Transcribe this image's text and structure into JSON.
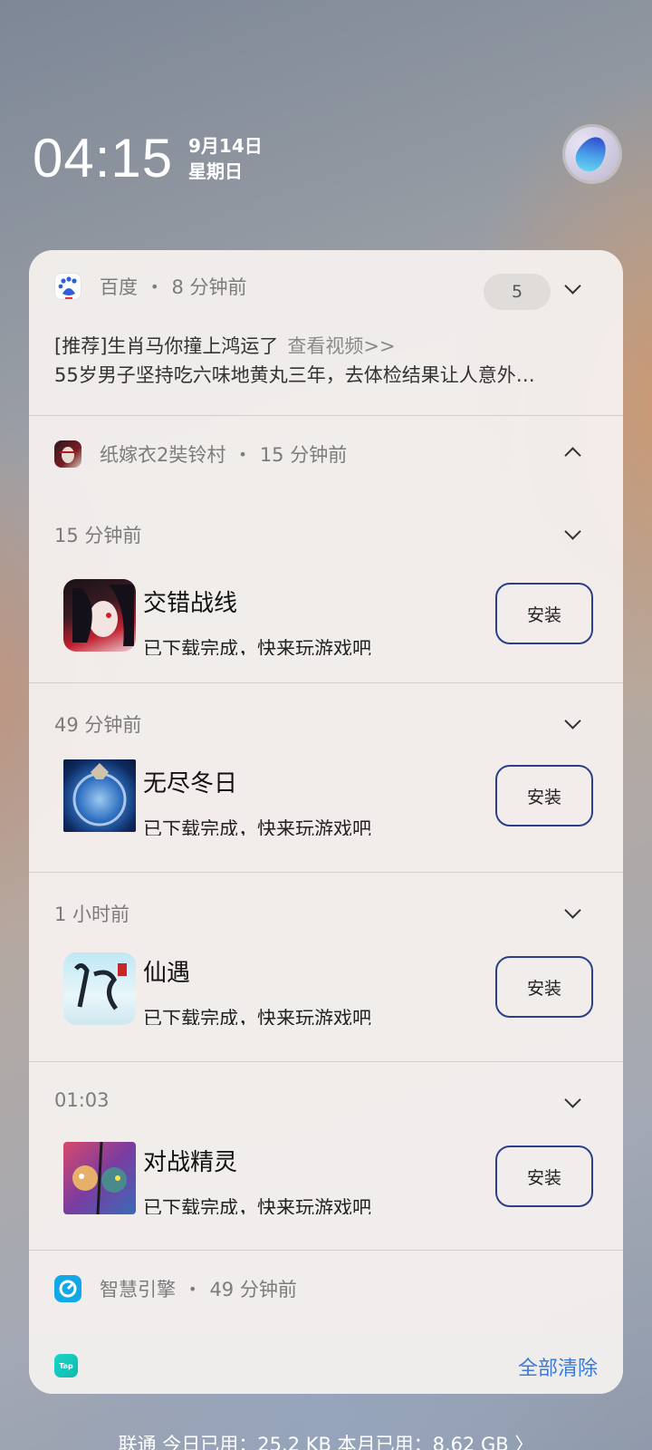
{
  "status": {
    "time": "04:15",
    "date": "9月14日",
    "weekday": "星期日"
  },
  "baidu": {
    "app_name": "百度",
    "time": "8 分钟前",
    "count": "5",
    "line1": "[推荐]生肖马你撞上鸿运了",
    "line1_link": "查看视频>>",
    "line2": "55岁男子坚持吃六味地黄丸三年，去体检结果让人意外…"
  },
  "game_group": {
    "app_name": "纸嫁衣2奘铃村",
    "time": "15 分钟前",
    "items": [
      {
        "time": "15 分钟前",
        "title": "交错战线",
        "desc": "已下载完成，快来玩游戏吧",
        "button": "安装"
      },
      {
        "time": "49 分钟前",
        "title": "无尽冬日",
        "desc": "已下载完成，快来玩游戏吧",
        "button": "安装"
      },
      {
        "time": "1 小时前",
        "title": "仙遇",
        "desc": "已下载完成，快来玩游戏吧",
        "button": "安装"
      },
      {
        "time": "01:03",
        "title": "对战精灵",
        "desc": "已下载完成，快来玩游戏吧",
        "button": "安装"
      }
    ]
  },
  "smart_engine": {
    "app_name": "智慧引擎",
    "time": "49 分钟前"
  },
  "footer": {
    "tap_icon_text": "Tap",
    "clear_all": "全部清除"
  },
  "data_usage": "联通 今日已用：25.2 KB 本月已用：8.62 GB 〉",
  "colors": {
    "accent_link": "#3c7ad6",
    "install_border": "#2c3f88"
  }
}
